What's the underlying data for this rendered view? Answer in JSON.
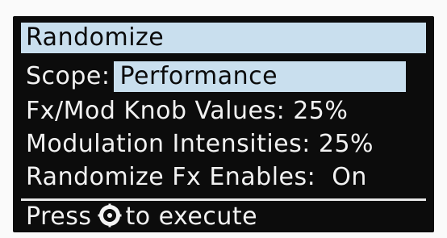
{
  "title": "Randomize",
  "scope": {
    "label": "Scope:",
    "value": "Performance"
  },
  "settings": [
    {
      "label": "Fx/Mod Knob Values:",
      "value": "25%"
    },
    {
      "label": "Modulation Intensities:",
      "value": "25%"
    },
    {
      "label": "Randomize Fx Enables:",
      "value": "On"
    }
  ],
  "footer": {
    "prefix": "Press",
    "icon": "knob-icon",
    "suffix": "to execute"
  },
  "colors": {
    "screen_bg": "#0c0c0c",
    "highlight": "#c9dfee",
    "text": "#f2f2f2"
  }
}
